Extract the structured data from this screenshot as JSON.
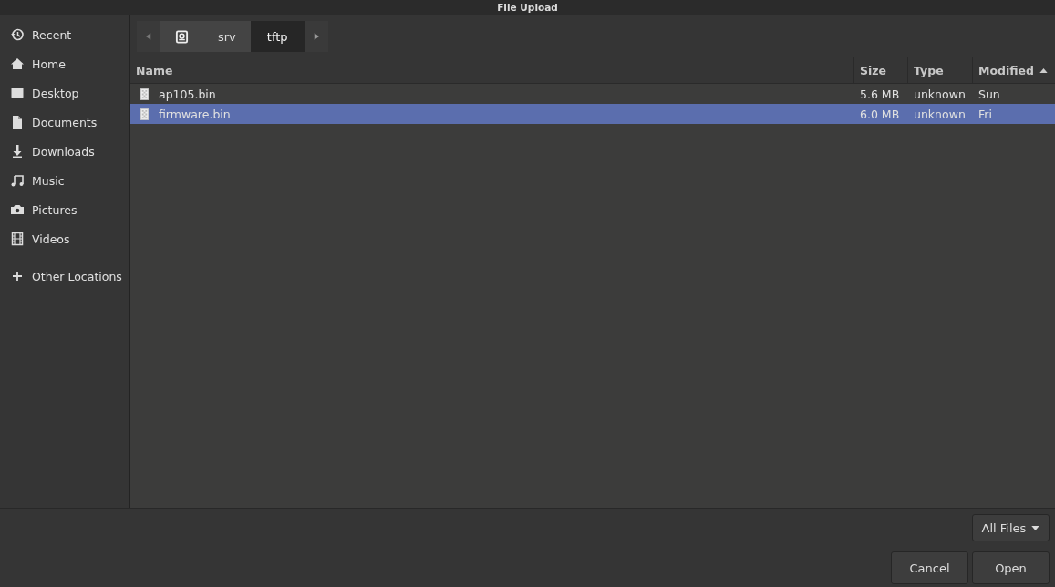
{
  "window": {
    "title": "File Upload"
  },
  "sidebar": {
    "places": [
      {
        "label": "Recent"
      },
      {
        "label": "Home"
      },
      {
        "label": "Desktop"
      },
      {
        "label": "Documents"
      },
      {
        "label": "Downloads"
      },
      {
        "label": "Music"
      },
      {
        "label": "Pictures"
      },
      {
        "label": "Videos"
      }
    ],
    "other_locations": {
      "label": "Other Locations"
    }
  },
  "path_bar": {
    "segments": [
      {
        "kind": "drive",
        "selected": false
      },
      {
        "label": "srv",
        "kind": "folder",
        "selected": false
      },
      {
        "label": "tftp",
        "kind": "folder",
        "selected": true
      }
    ]
  },
  "table": {
    "columns": [
      {
        "label": "Name",
        "sorted": false
      },
      {
        "label": "Size",
        "sorted": false
      },
      {
        "label": "Type",
        "sorted": false
      },
      {
        "label": "Modified",
        "sorted": true
      }
    ],
    "rows": [
      {
        "name": "ap105.bin",
        "size": "5.6 MB",
        "type": "unknown",
        "modified": "Sun",
        "selected": false
      },
      {
        "name": "firmware.bin",
        "size": "6.0 MB",
        "type": "unknown",
        "modified": "Fri",
        "selected": true
      }
    ]
  },
  "filter": {
    "value": "All Files"
  },
  "buttons": [
    {
      "label": "Cancel"
    },
    {
      "label": "Open"
    }
  ]
}
